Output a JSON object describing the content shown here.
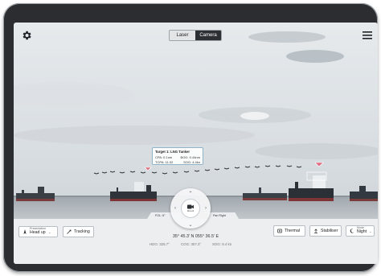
{
  "header": {
    "tabs": [
      {
        "label": "Laser",
        "active": false
      },
      {
        "label": "Camera",
        "active": true
      }
    ]
  },
  "target": {
    "title": "Target 1: LNG Tanker",
    "cpa": "CPA: 0.1nm",
    "sog": "SOG: 4.4kn",
    "tcpa": "TCPA: 11:32",
    "bog": "BOG: 0.44nm"
  },
  "joystick": {
    "center_label": "Record"
  },
  "pan": {
    "left_label": "FOL: 6°",
    "right_label": "Pan Right"
  },
  "controls": {
    "presentation_label": "Presentation",
    "presentation_value": "Head up",
    "tracking_label": "Tracking",
    "thermal_label": "Thermal",
    "stabiliser_label": "Stabiliser",
    "mode_label": "Mode",
    "mode_value": "Night"
  },
  "readout": {
    "coordinates": "35° 45.3' N  055° 36.5' E",
    "hdg": "HDG: 325.7°",
    "cog": "COG: 307.3°",
    "sog": "SOG: 8.4 kn"
  },
  "colors": {
    "bezel": "#2b2d30",
    "active_tab": "#2c2f33",
    "target_marker": "#e06a80",
    "bottom_bar": "#eceef0"
  },
  "icons": {
    "settings": "gear-icon",
    "menu": "hamburger-menu-icon",
    "record": "camera-record-icon"
  }
}
